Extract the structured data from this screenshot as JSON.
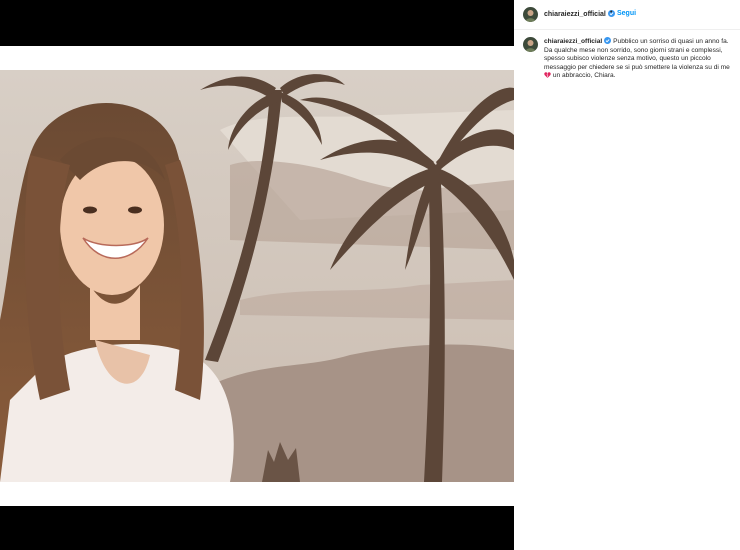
{
  "post": {
    "username": "chiaraiezzi_official",
    "separator": "•",
    "follow_label": "Segui",
    "caption_before_emoji": "Pubblico un sorriso di quasi un anno fa. Da qualche mese non sorrido, sono giorni strani e complessi, spesso subisco violenze senza motivo, questo un piccolo messaggio per chiedere se si può smettere la violenza su di me",
    "caption_after_emoji": " un abbraccio, Chiara.",
    "emoji_icon": "broken-heart-icon",
    "verified_icon": "verified-badge-icon"
  },
  "colors": {
    "link_blue": "#0095f6",
    "text": "#262626",
    "verified": "#3897f0",
    "heart": "#e0245e"
  }
}
